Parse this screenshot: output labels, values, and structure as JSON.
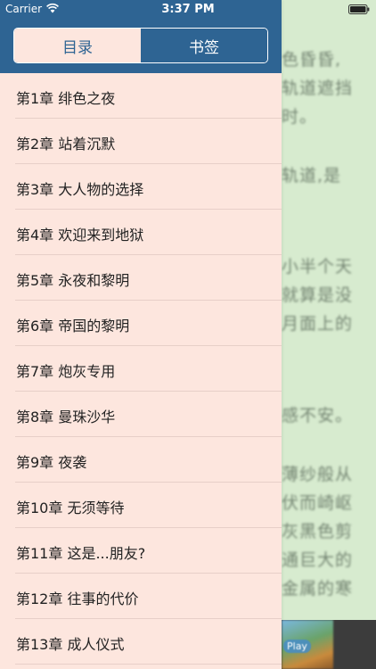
{
  "status_bar": {
    "carrier": "Carrier",
    "time": "3:37 PM",
    "wifi_icon": "wifi-icon",
    "battery_icon": "battery-icon"
  },
  "tabs": {
    "contents": "目录",
    "bookmarks": "书签",
    "active": "contents"
  },
  "chapters": [
    "第1章 绯色之夜",
    "第2章 站着沉默",
    "第3章 大人物的选择",
    "第4章 欢迎来到地狱",
    "第5章 永夜和黎明",
    "第6章 帝国的黎明",
    "第7章 炮灰专用",
    "第8章 曼珠沙华",
    "第9章 夜袭",
    "第10章 无须等待",
    "第11章 这是...朋友?",
    "第12章 往事的代价",
    "第13章 成人仪式"
  ],
  "reader": {
    "lines": [
      "色昏昏,",
      "轨道遮挡",
      "时。",
      "轨道,是",
      "小半个天",
      "就算是没",
      "月面上的",
      "感不安。",
      "薄纱般从",
      "伏而崎岖",
      "灰黑色剪",
      "通巨大的",
      "金属的寒"
    ]
  },
  "ad": {
    "label": "Play"
  },
  "colors": {
    "header": "#2e6493",
    "drawer_bg": "#fde6de",
    "reader_bg": "#d7ebcf"
  }
}
